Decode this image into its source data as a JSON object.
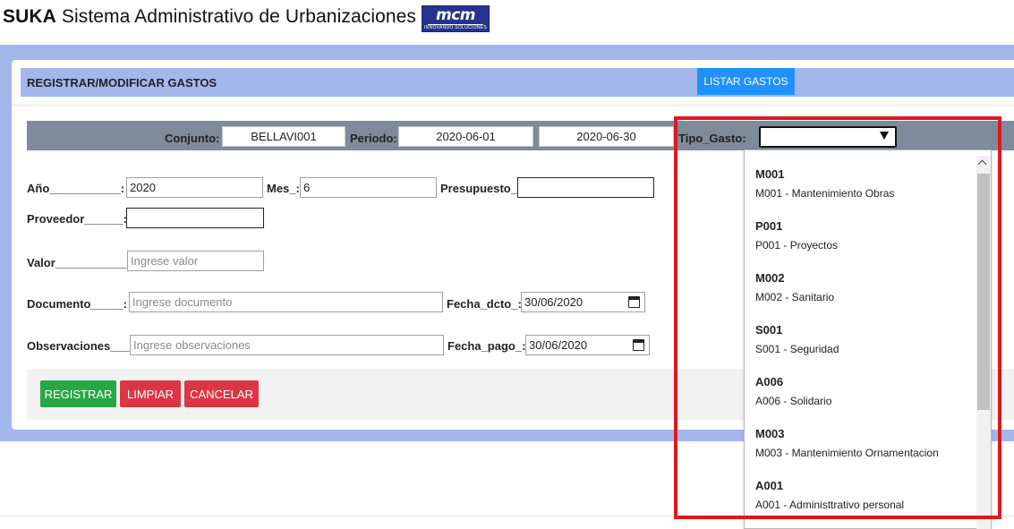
{
  "header": {
    "app_short": "SUKA",
    "app_name": "Sistema Administrativo de Urbanizaciones",
    "logo_text": "mcm",
    "logo_tagline": "INNOVANDO   SOLUCIONES"
  },
  "card": {
    "title": "REGISTRAR/MODIFICAR GASTOS",
    "list_button": "LISTAR GASTOS"
  },
  "filter": {
    "conjunto_label": "Conjunto:",
    "conjunto_value": "BELLAVI001",
    "periodo_label": "Periodo:",
    "periodo_start": "2020-06-01",
    "periodo_end": "2020-06-30",
    "tipo_gasto_label": "Tipo_Gasto:",
    "tipo_gasto_value": ""
  },
  "form": {
    "anio_label": "Año___________:",
    "anio_value": "2020",
    "mes_label": "Mes_:",
    "mes_value": "6",
    "presupuesto_label": "Presupuesto_:",
    "presupuesto_value": "",
    "proveedor_label": "Proveedor______:",
    "proveedor_value": "",
    "valor_label": "Valor___________:",
    "valor_placeholder": "Ingrese valor",
    "documento_label": "Documento_____:",
    "documento_placeholder": "Ingrese documento",
    "fecha_dcto_label": "Fecha_dcto_:",
    "fecha_dcto_value": "30/06/2020",
    "observaciones_label": "Observaciones___:",
    "observaciones_placeholder": "Ingrese observaciones",
    "fecha_pago_label": "Fecha_pago_:",
    "fecha_pago_value": "30/06/2020"
  },
  "actions": {
    "register": "REGISTRAR",
    "clear": "LIMPIAR",
    "cancel": "CANCELAR"
  },
  "dropdown": {
    "options": [
      {
        "code": "M001",
        "desc": "M001 - Mantenimiento Obras"
      },
      {
        "code": "P001",
        "desc": "P001 - Proyectos"
      },
      {
        "code": "M002",
        "desc": "M002 - Sanitario"
      },
      {
        "code": "S001",
        "desc": "S001 - Seguridad"
      },
      {
        "code": "A006",
        "desc": "A006 - Solidario"
      },
      {
        "code": "M003",
        "desc": "M003 - Mantenimiento Ornamentacion"
      },
      {
        "code": "A001",
        "desc": "A001 - Administtrativo personal"
      }
    ]
  },
  "colors": {
    "band": "#a4b7ec",
    "filter_bar": "#7d8b9a",
    "primary": "#1e90ff",
    "success": "#28a745",
    "danger": "#dc3545",
    "highlight": "#e0181e"
  }
}
